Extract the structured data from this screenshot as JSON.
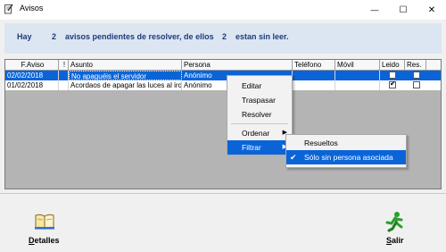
{
  "window": {
    "title": "Avisos",
    "minimize_glyph": "—",
    "maximize_glyph": "☐",
    "close_glyph": "✕"
  },
  "banner": {
    "hay": "Hay",
    "count_total": "2",
    "middle": "avisos pendientes de resolver, de ellos",
    "count_unread": "2",
    "end": "estan sin leer."
  },
  "table": {
    "columns": [
      "F.Aviso",
      "!",
      "Asunto",
      "Persona",
      "Teléfono",
      "Móvil",
      "Leido",
      "Res."
    ],
    "rows": [
      {
        "fecha": "02/02/2018",
        "flag": "",
        "asunto": "No apaguéis el servidor",
        "persona": "Anónimo",
        "telefono": "",
        "movil": "",
        "leido": false,
        "res": false,
        "selected": true
      },
      {
        "fecha": "01/02/2018",
        "flag": "",
        "asunto": "Acordaos de apagar las luces al iro",
        "persona": "Anónimo",
        "telefono": "",
        "movil": "",
        "leido": true,
        "res": false,
        "selected": false
      }
    ]
  },
  "context_menu": {
    "items": [
      "Editar",
      "Traspasar",
      "Resolver",
      "Ordenar",
      "Filtrar"
    ],
    "submenu_arrow": "▶"
  },
  "submenu": {
    "items": [
      "Resueltos",
      "Sólo sin persona asociada"
    ],
    "checked_glyph": "✔"
  },
  "buttons": {
    "detalles_first": "D",
    "detalles_rest": "etalles",
    "salir_first": "S",
    "salir_rest": "alir"
  },
  "colors": {
    "selection": "#0a64d8",
    "banner_bg": "#dce6f2",
    "banner_text": "#1f3a7a"
  }
}
